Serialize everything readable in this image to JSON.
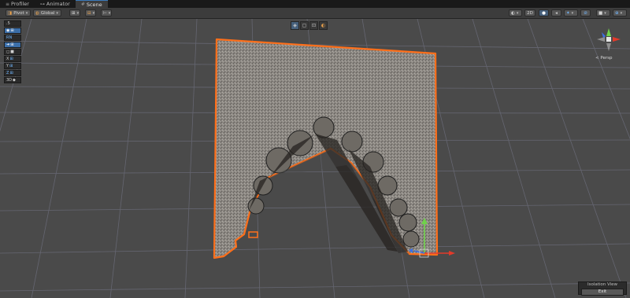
{
  "tabs": [
    {
      "label": "Profiler",
      "icon": "profiler-icon"
    },
    {
      "label": "Animator",
      "icon": "animator-icon"
    },
    {
      "label": "Scene",
      "icon": "scene-icon",
      "active": true
    }
  ],
  "toolbar": {
    "pivot_label": "Pivot",
    "global_label": "Global",
    "mode_2d_label": "2D"
  },
  "left_tools": {
    "items": [
      ".5",
      "",
      "RN",
      "",
      "",
      "X",
      "Y",
      "Z",
      "3D"
    ]
  },
  "gizmo": {
    "projection_label": "< Persp"
  },
  "isolation": {
    "title": "Isolation View",
    "exit_label": "Exit"
  },
  "colors": {
    "background": "#4a4a4a",
    "grid": "#6a6b78",
    "selection_outline": "#ff6f1a",
    "mesh_fill": "#8a8782",
    "axis_x": "#e23a2a",
    "axis_y": "#6fd24a",
    "axis_z": "#3d6fe6"
  }
}
